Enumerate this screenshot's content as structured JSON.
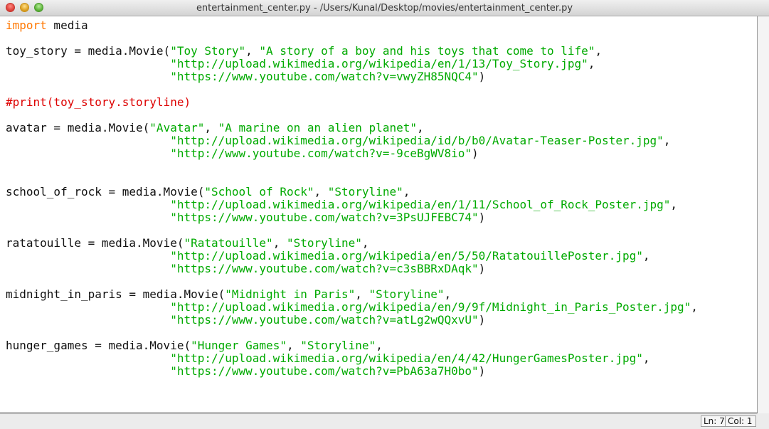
{
  "window": {
    "title": "entertainment_center.py - /Users/Kunal/Desktop/movies/entertainment_center.py"
  },
  "colors": {
    "keyword": "#ff7700",
    "string": "#00aa00",
    "comment": "#dd0000",
    "text": "#111111"
  },
  "editor": {
    "lines": [
      [
        {
          "t": "kw",
          "v": "import"
        },
        {
          "t": "p",
          "v": " media"
        }
      ],
      [],
      [
        {
          "t": "p",
          "v": "toy_story = media.Movie("
        },
        {
          "t": "s",
          "v": "\"Toy Story\""
        },
        {
          "t": "p",
          "v": ", "
        },
        {
          "t": "s",
          "v": "\"A story of a boy and his toys that come to life\""
        },
        {
          "t": "p",
          "v": ","
        }
      ],
      [
        {
          "t": "p",
          "v": "                        "
        },
        {
          "t": "s",
          "v": "\"http://upload.wikimedia.org/wikipedia/en/1/13/Toy_Story.jpg\""
        },
        {
          "t": "p",
          "v": ","
        }
      ],
      [
        {
          "t": "p",
          "v": "                        "
        },
        {
          "t": "s",
          "v": "\"https://www.youtube.com/watch?v=vwyZH85NQC4\""
        },
        {
          "t": "p",
          "v": ")"
        }
      ],
      [],
      [
        {
          "t": "c",
          "v": "#print(toy_story.storyline)"
        }
      ],
      [],
      [
        {
          "t": "p",
          "v": "avatar = media.Movie("
        },
        {
          "t": "s",
          "v": "\"Avatar\""
        },
        {
          "t": "p",
          "v": ", "
        },
        {
          "t": "s",
          "v": "\"A marine on an alien planet\""
        },
        {
          "t": "p",
          "v": ","
        }
      ],
      [
        {
          "t": "p",
          "v": "                        "
        },
        {
          "t": "s",
          "v": "\"http://upload.wikimedia.org/wikipedia/id/b/b0/Avatar-Teaser-Poster.jpg\""
        },
        {
          "t": "p",
          "v": ","
        }
      ],
      [
        {
          "t": "p",
          "v": "                        "
        },
        {
          "t": "s",
          "v": "\"http://www.youtube.com/watch?v=-9ceBgWV8io\""
        },
        {
          "t": "p",
          "v": ")"
        }
      ],
      [],
      [],
      [
        {
          "t": "p",
          "v": "school_of_rock = media.Movie("
        },
        {
          "t": "s",
          "v": "\"School of Rock\""
        },
        {
          "t": "p",
          "v": ", "
        },
        {
          "t": "s",
          "v": "\"Storyline\""
        },
        {
          "t": "p",
          "v": ","
        }
      ],
      [
        {
          "t": "p",
          "v": "                        "
        },
        {
          "t": "s",
          "v": "\"http://upload.wikimedia.org/wikipedia/en/1/11/School_of_Rock_Poster.jpg\""
        },
        {
          "t": "p",
          "v": ","
        }
      ],
      [
        {
          "t": "p",
          "v": "                        "
        },
        {
          "t": "s",
          "v": "\"https://www.youtube.com/watch?v=3PsUJFEBC74\""
        },
        {
          "t": "p",
          "v": ")"
        }
      ],
      [],
      [
        {
          "t": "p",
          "v": "ratatouille = media.Movie("
        },
        {
          "t": "s",
          "v": "\"Ratatouille\""
        },
        {
          "t": "p",
          "v": ", "
        },
        {
          "t": "s",
          "v": "\"Storyline\""
        },
        {
          "t": "p",
          "v": ","
        }
      ],
      [
        {
          "t": "p",
          "v": "                        "
        },
        {
          "t": "s",
          "v": "\"http://upload.wikimedia.org/wikipedia/en/5/50/RatatouillePoster.jpg\""
        },
        {
          "t": "p",
          "v": ","
        }
      ],
      [
        {
          "t": "p",
          "v": "                        "
        },
        {
          "t": "s",
          "v": "\"https://www.youtube.com/watch?v=c3sBBRxDAqk\""
        },
        {
          "t": "p",
          "v": ")"
        }
      ],
      [],
      [
        {
          "t": "p",
          "v": "midnight_in_paris = media.Movie("
        },
        {
          "t": "s",
          "v": "\"Midnight in Paris\""
        },
        {
          "t": "p",
          "v": ", "
        },
        {
          "t": "s",
          "v": "\"Storyline\""
        },
        {
          "t": "p",
          "v": ","
        }
      ],
      [
        {
          "t": "p",
          "v": "                        "
        },
        {
          "t": "s",
          "v": "\"http://upload.wikimedia.org/wikipedia/en/9/9f/Midnight_in_Paris_Poster.jpg\""
        },
        {
          "t": "p",
          "v": ","
        }
      ],
      [
        {
          "t": "p",
          "v": "                        "
        },
        {
          "t": "s",
          "v": "\"https://www.youtube.com/watch?v=atLg2wQQxvU\""
        },
        {
          "t": "p",
          "v": ")"
        }
      ],
      [],
      [
        {
          "t": "p",
          "v": "hunger_games = media.Movie("
        },
        {
          "t": "s",
          "v": "\"Hunger Games\""
        },
        {
          "t": "p",
          "v": ", "
        },
        {
          "t": "s",
          "v": "\"Storyline\""
        },
        {
          "t": "p",
          "v": ","
        }
      ],
      [
        {
          "t": "p",
          "v": "                        "
        },
        {
          "t": "s",
          "v": "\"http://upload.wikimedia.org/wikipedia/en/4/42/HungerGamesPoster.jpg\""
        },
        {
          "t": "p",
          "v": ","
        }
      ],
      [
        {
          "t": "p",
          "v": "                        "
        },
        {
          "t": "s",
          "v": "\"https://www.youtube.com/watch?v=PbA63a7H0bo\""
        },
        {
          "t": "p",
          "v": ")"
        }
      ]
    ]
  },
  "statusbar": {
    "line": "Ln: 7",
    "column": "Col: 1"
  }
}
